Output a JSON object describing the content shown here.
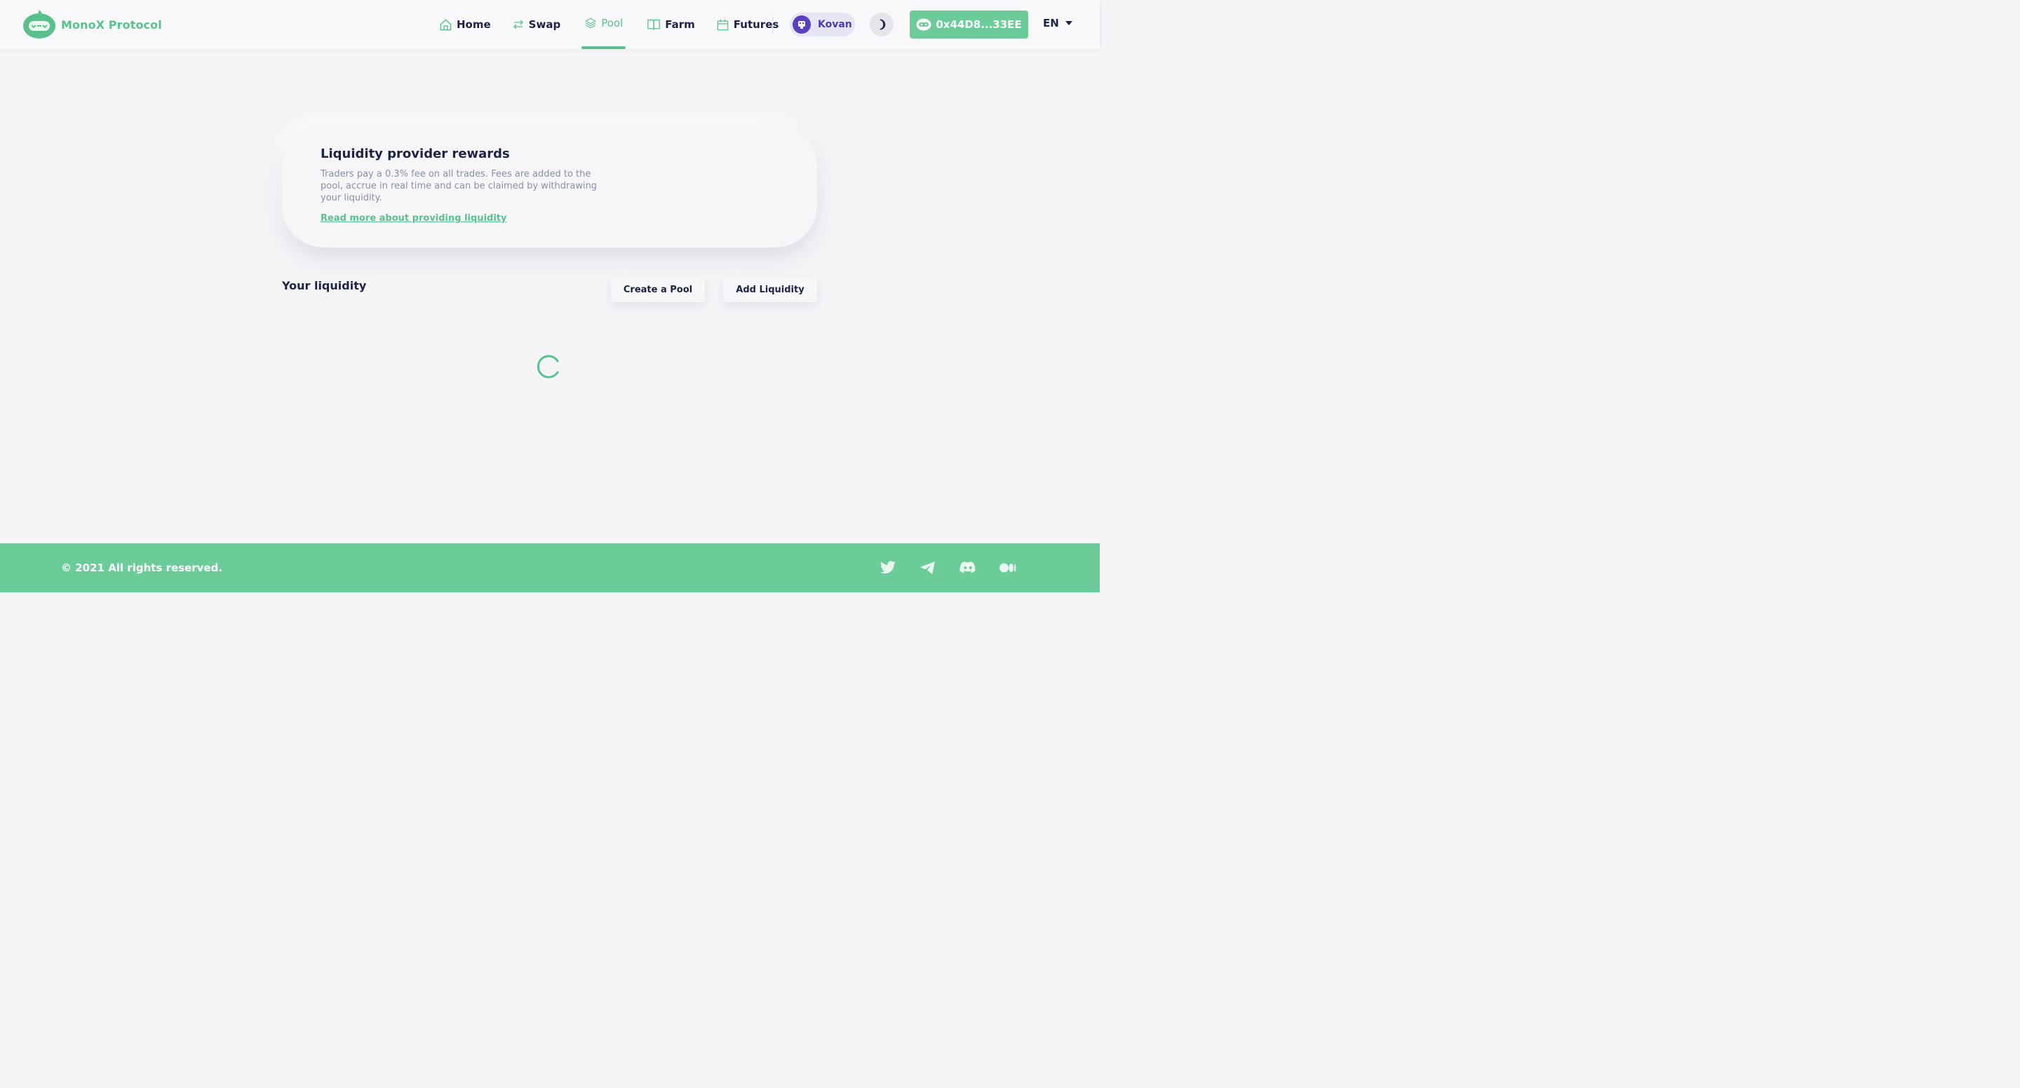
{
  "brand": {
    "name": "MonoX Protocol",
    "accent": "#5cc08e"
  },
  "nav": [
    {
      "label": "Home",
      "icon": "home-icon"
    },
    {
      "label": "Swap",
      "icon": "swap-icon"
    },
    {
      "label": "Pool",
      "icon": "layers-icon",
      "active": true
    },
    {
      "label": "Farm",
      "icon": "book-icon"
    },
    {
      "label": "Futures",
      "icon": "calendar-icon"
    }
  ],
  "network": {
    "label": "Kovan"
  },
  "wallet": {
    "address": "0x44D8...33EE"
  },
  "language": {
    "selected": "EN"
  },
  "info": {
    "title": "Liquidity provider rewards",
    "description": "Traders pay a 0.3% fee on all trades. Fees are added to the pool, accrue in real time and can be claimed by withdrawing your liquidity.",
    "link": "Read more about providing liquidity"
  },
  "liquidity": {
    "title": "Your liquidity",
    "create_label": "Create a Pool",
    "add_label": "Add Liquidity"
  },
  "footer": {
    "copyright": "© 2021 All rights reserved.",
    "socials": [
      "twitter-icon",
      "telegram-icon",
      "discord-icon",
      "medium-icon"
    ]
  }
}
